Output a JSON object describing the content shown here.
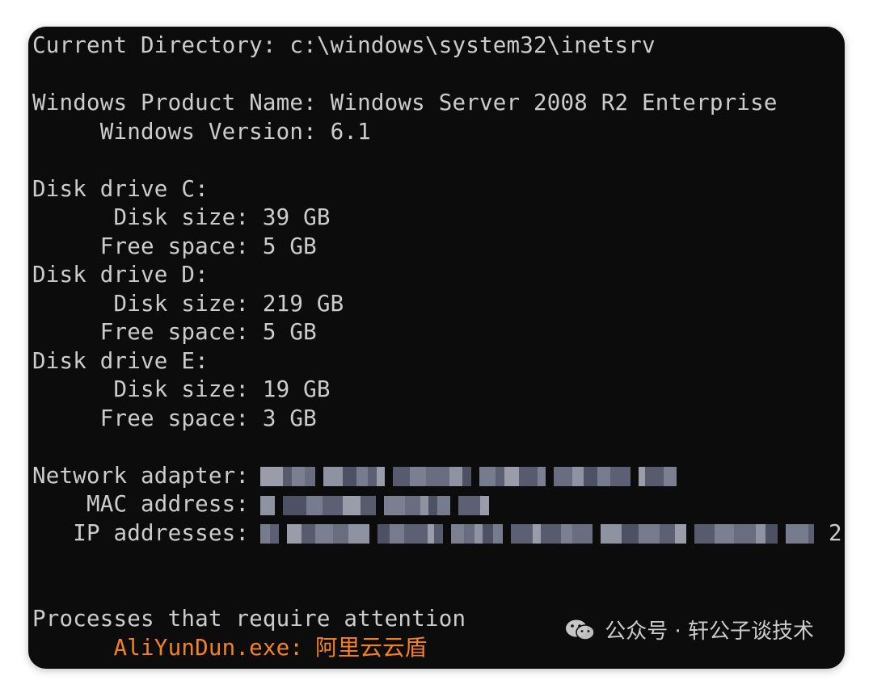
{
  "console": {
    "current_directory_line": "Current Directory: c:\\windows\\system32\\inetsrv",
    "product_name_line": "Windows Product Name: Windows Server 2008 R2 Enterprise",
    "version_line": "     Windows Version: 6.1",
    "disks": [
      {
        "header": "Disk drive C:",
        "size_line": "      Disk size: 39 GB",
        "free_line": "     Free space: 5 GB"
      },
      {
        "header": "Disk drive D:",
        "size_line": "      Disk size: 219 GB",
        "free_line": "     Free space: 5 GB"
      },
      {
        "header": "Disk drive E:",
        "size_line": "      Disk size: 19 GB",
        "free_line": "     Free space: 3 GB"
      }
    ],
    "network": {
      "adapter_label": "Network adapter:",
      "mac_label": "    MAC address:",
      "ip_label": "   IP addresses:",
      "ip_tail": "2"
    },
    "processes_header": "Processes that require attention",
    "process_name": "      AliYunDun.exe:",
    "process_desc": "阿里云云盾",
    "process_color": "#f58220"
  },
  "watermark": {
    "text": "公众号 · 轩公子谈技术"
  }
}
